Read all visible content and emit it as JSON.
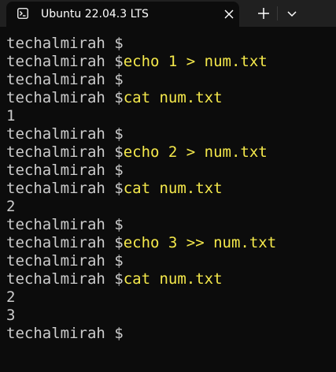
{
  "tab": {
    "title": "Ubuntu 22.04.3 LTS",
    "icon": "terminal-icon",
    "close_icon": "close-icon"
  },
  "toolbar": {
    "new_tab_icon": "plus-icon",
    "dropdown_icon": "chevron-down-icon"
  },
  "colors": {
    "background": "#0c0c0c",
    "titlebar": "#202020",
    "text": "#cccccc",
    "command": "#f5e94b"
  },
  "terminal": {
    "lines": [
      {
        "prompt": "techalmirah $",
        "cmd": ""
      },
      {
        "prompt": "techalmirah $",
        "cmd": "echo 1 > num.txt"
      },
      {
        "prompt": "techalmirah $",
        "cmd": ""
      },
      {
        "prompt": "techalmirah $",
        "cmd": "cat num.txt"
      },
      {
        "out": "1"
      },
      {
        "prompt": "techalmirah $",
        "cmd": ""
      },
      {
        "prompt": "techalmirah $",
        "cmd": "echo 2 > num.txt"
      },
      {
        "prompt": "techalmirah $",
        "cmd": ""
      },
      {
        "prompt": "techalmirah $",
        "cmd": "cat num.txt"
      },
      {
        "out": "2"
      },
      {
        "prompt": "techalmirah $",
        "cmd": ""
      },
      {
        "prompt": "techalmirah $",
        "cmd": "echo 3 >> num.txt"
      },
      {
        "prompt": "techalmirah $",
        "cmd": ""
      },
      {
        "prompt": "techalmirah $",
        "cmd": "cat num.txt"
      },
      {
        "out": "2"
      },
      {
        "out": "3"
      },
      {
        "prompt": "techalmirah $",
        "cmd": ""
      }
    ]
  }
}
